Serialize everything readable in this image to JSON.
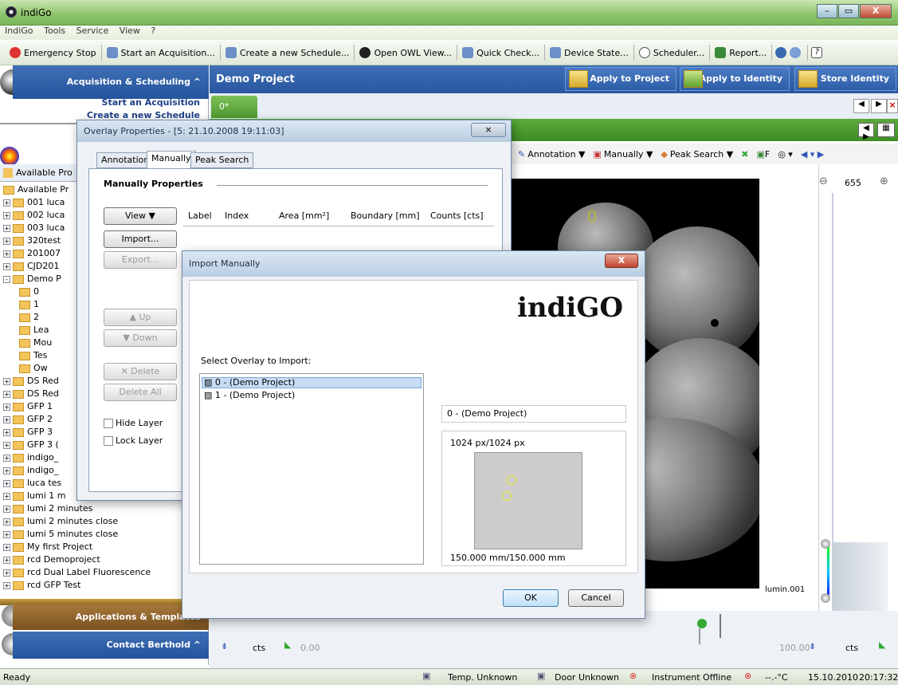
{
  "window": {
    "title": "indiGo",
    "min": "–",
    "max": "▭",
    "close": "X"
  },
  "menu": [
    "IndiGo",
    "Tools",
    "Service",
    "View",
    "?"
  ],
  "toolbar": [
    {
      "label": "Emergency Stop",
      "color": "#d33"
    },
    {
      "label": "Start an Acquisition...",
      "color": "#6b8fc6"
    },
    {
      "label": "Create a new Schedule...",
      "color": "#6b8fc6"
    },
    {
      "label": "Open OWL View...",
      "color": "#222"
    },
    {
      "label": "Quick Check...",
      "color": "#6b8fc6"
    },
    {
      "label": "Device State...",
      "color": "#6b8fc6"
    },
    {
      "label": "Scheduler...",
      "color": "#888"
    },
    {
      "label": "Report...",
      "color": "#3a8a3a"
    }
  ],
  "left": {
    "acq_header": "Acquisition & Scheduling",
    "acq_links": [
      "Start an Acquisition",
      "Create a new Schedule"
    ],
    "available_tab": "Available Pro",
    "tree": [
      {
        "pm": "",
        "label": "Available Pr",
        "indent": 0
      },
      {
        "pm": "+",
        "label": "001 luca",
        "indent": 0
      },
      {
        "pm": "+",
        "label": "002 luca",
        "indent": 0
      },
      {
        "pm": "+",
        "label": "003 luca",
        "indent": 0
      },
      {
        "pm": "+",
        "label": "320test",
        "indent": 0
      },
      {
        "pm": "+",
        "label": "201007",
        "indent": 0
      },
      {
        "pm": "+",
        "label": "CJD201",
        "indent": 0
      },
      {
        "pm": "-",
        "label": "Demo P",
        "indent": 0
      },
      {
        "pm": "",
        "label": "0",
        "indent": 1
      },
      {
        "pm": "",
        "label": "1",
        "indent": 1
      },
      {
        "pm": "",
        "label": "2",
        "indent": 1
      },
      {
        "pm": "",
        "label": "Lea",
        "indent": 1
      },
      {
        "pm": "",
        "label": "Mou",
        "indent": 1
      },
      {
        "pm": "",
        "label": "Tes",
        "indent": 1
      },
      {
        "pm": "",
        "label": "Ow",
        "indent": 1
      },
      {
        "pm": "+",
        "label": "DS Red",
        "indent": 0
      },
      {
        "pm": "+",
        "label": "DS Red",
        "indent": 0
      },
      {
        "pm": "+",
        "label": "GFP 1",
        "indent": 0
      },
      {
        "pm": "+",
        "label": "GFP 2",
        "indent": 0
      },
      {
        "pm": "+",
        "label": "GFP 3",
        "indent": 0
      },
      {
        "pm": "+",
        "label": "GFP 3 (",
        "indent": 0
      },
      {
        "pm": "+",
        "label": "indigo_",
        "indent": 0
      },
      {
        "pm": "+",
        "label": "indigo_",
        "indent": 0
      },
      {
        "pm": "+",
        "label": "luca tes",
        "indent": 0
      },
      {
        "pm": "+",
        "label": "lumi 1 m",
        "indent": 0
      },
      {
        "pm": "+",
        "label": "lumi 2 minutes",
        "indent": 0
      },
      {
        "pm": "+",
        "label": "lumi 2 minutes close",
        "indent": 0
      },
      {
        "pm": "+",
        "label": "lumi 5 minutes close",
        "indent": 0
      },
      {
        "pm": "+",
        "label": "My first Project",
        "indent": 0
      },
      {
        "pm": "+",
        "label": "rcd Demoproject",
        "indent": 0
      },
      {
        "pm": "+",
        "label": "rcd Dual Label Fluorescence",
        "indent": 0
      },
      {
        "pm": "+",
        "label": "rcd GFP Test",
        "indent": 0
      }
    ],
    "apps_header": "Applications & Templates",
    "contact_header": "Contact Berthold"
  },
  "main": {
    "title": "Demo Project",
    "apply_project": "Apply to Project",
    "apply_identity": "Apply to Identity",
    "store_identity": "Store Identity",
    "tab": "0*",
    "img_toolbar": [
      "Annotation ▼",
      "Manually ▼",
      "Peak Search ▼",
      "F"
    ],
    "zoom": "655",
    "image_label": "lumin.001",
    "bottom_left_unit": "cts",
    "bottom_left_value": "0.00",
    "bottom_right_value": "100.00",
    "bottom_right_unit": "cts"
  },
  "overlay": {
    "title": "Overlay Properties - [5: 21.10.2008 19:11:03]",
    "tabs": [
      "Annotation",
      "Manually",
      "Peak Search"
    ],
    "heading": "Manually Properties",
    "view": "View",
    "import": "Import...",
    "export": "Export...",
    "up": "Up",
    "down": "Down",
    "delete": "Delete",
    "delete_all": "Delete All",
    "hide_layer": "Hide Layer",
    "lock_layer": "Lock Layer",
    "columns": [
      "Label",
      "Index",
      "Area [mm²]",
      "Boundary [mm]",
      "Counts [cts]"
    ]
  },
  "import": {
    "title": "Import Manually",
    "logo": "indiGO",
    "prompt": "Select Overlay to Import:",
    "items": [
      "0 - (Demo Project)",
      "1 - (Demo Project)"
    ],
    "selected": "0 - (Demo Project)",
    "dims_px": "1024 px/1024 px",
    "dims_mm": "150.000 mm/150.000 mm",
    "ok": "OK",
    "cancel": "Cancel"
  },
  "status": {
    "ready": "Ready",
    "temp": "Temp. Unknown",
    "door": "Door Unknown",
    "instrument": "Instrument Offline",
    "celsius": "--.-°C",
    "date": "15.10.2010",
    "time": "20:17:32"
  }
}
